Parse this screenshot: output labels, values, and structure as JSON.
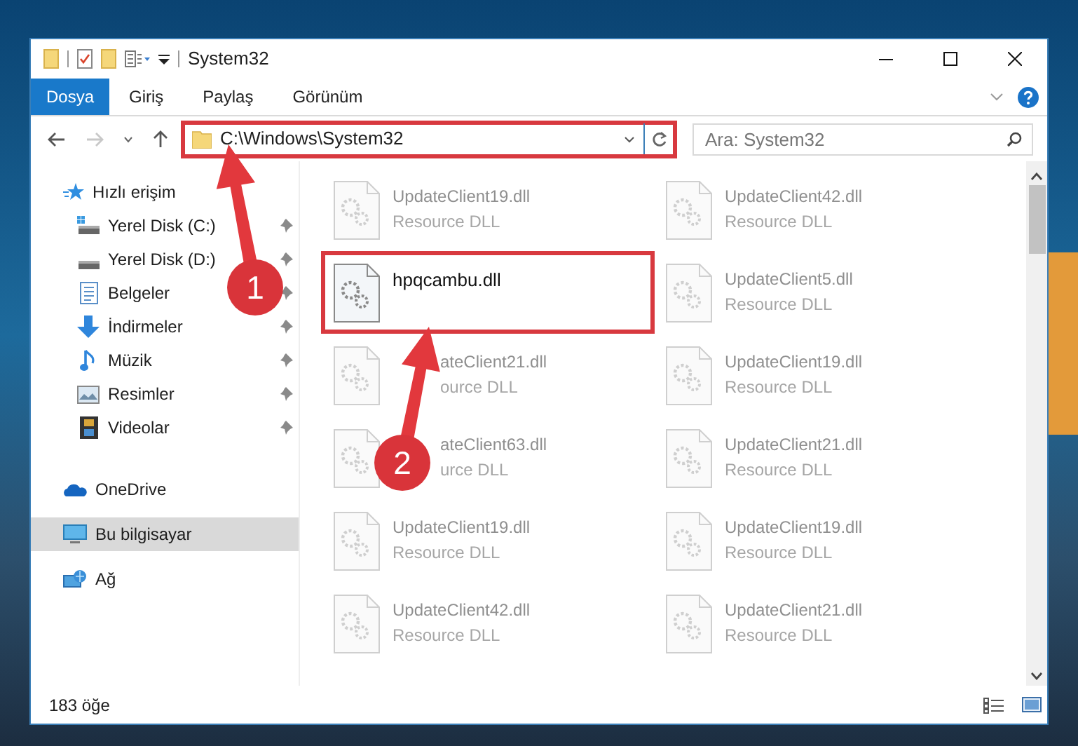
{
  "window": {
    "title": "System32"
  },
  "ribbon_tabs": [
    {
      "label": "Dosya",
      "kind": "file"
    },
    {
      "label": "Giriş",
      "kind": "tab"
    },
    {
      "label": "Paylaş",
      "kind": "tab"
    },
    {
      "label": "Görünüm",
      "kind": "tab"
    }
  ],
  "address_bar": {
    "path": "C:\\Windows\\System32",
    "highlighted": true
  },
  "search": {
    "placeholder": "Ara: System32"
  },
  "sidebar": {
    "items": [
      {
        "label": "Hızlı erişim",
        "selected": false,
        "children": [
          {
            "label": "Yerel Disk (C:)",
            "pinned": true
          },
          {
            "label": "Yerel Disk (D:)",
            "pinned": true
          },
          {
            "label": "Belgeler",
            "pinned": true
          },
          {
            "label": "İndirmeler",
            "pinned": true
          },
          {
            "label": "Müzik",
            "pinned": true
          },
          {
            "label": "Resimler",
            "pinned": true
          },
          {
            "label": "Videolar",
            "pinned": true
          }
        ]
      },
      {
        "label": "OneDrive",
        "selected": false
      },
      {
        "label": "Bu bilgisayar",
        "selected": true
      },
      {
        "label": "Ağ",
        "selected": false
      }
    ]
  },
  "files": [
    {
      "name": "UpdateClient19.dll",
      "type": "Resource DLL",
      "blurred": true
    },
    {
      "name": "UpdateClient42.dll",
      "type": "Resource DLL",
      "blurred": true
    },
    {
      "name": "hpqcambu.dll",
      "blurred": false,
      "highlighted": true
    },
    {
      "name": "UpdateClient5.dll",
      "type": "Resource DLL",
      "blurred": true
    },
    {
      "name": "ateClient21.dll",
      "type": "ource DLL",
      "blurred": true,
      "kind": "partly_covered"
    },
    {
      "name": "UpdateClient19.dll",
      "type": "Resource DLL",
      "blurred": true
    },
    {
      "name": "ateClient63.dll",
      "type": "urce DLL",
      "blurred": true,
      "kind": "partly_covered"
    },
    {
      "name": "UpdateClient21.dll",
      "type": "Resource DLL",
      "blurred": true
    },
    {
      "name": "UpdateClient19.dll",
      "type": "Resource DLL",
      "blurred": true
    },
    {
      "name": "UpdateClient19.dll",
      "type": "Resource DLL",
      "blurred": true
    },
    {
      "name": "UpdateClient42.dll",
      "type": "Resource DLL",
      "blurred": true
    },
    {
      "name": "UpdateClient21.dll",
      "type": "Resource DLL",
      "blurred": true
    }
  ],
  "step_markers": [
    {
      "label": "1"
    },
    {
      "label": "2"
    }
  ],
  "status_bar": {
    "item_count": "183 öğe"
  }
}
